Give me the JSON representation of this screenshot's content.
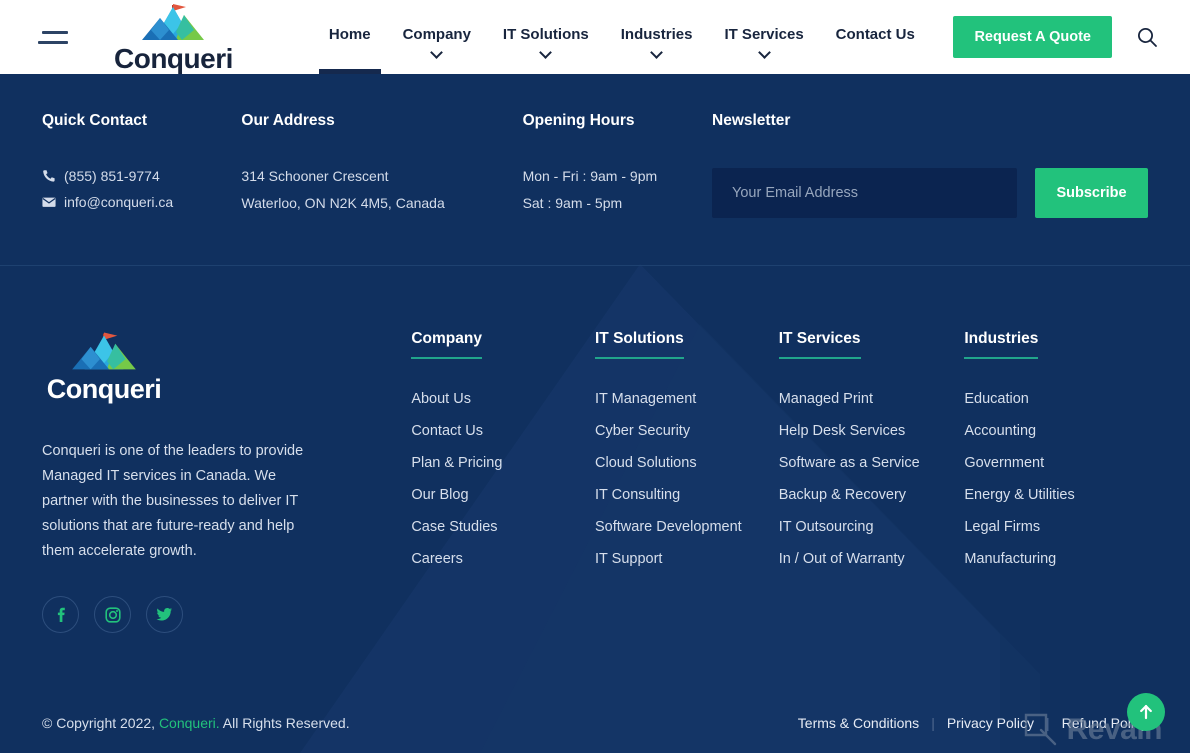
{
  "brand": {
    "name": "Conqueri",
    "accent_green": "#22c27c",
    "navy": "#10305f",
    "teal_underline": "#21a58b"
  },
  "header": {
    "menu_icon": "hamburger-icon",
    "nav": [
      {
        "label": "Home",
        "has_dropdown": false,
        "active": true
      },
      {
        "label": "Company",
        "has_dropdown": true,
        "active": false
      },
      {
        "label": "IT Solutions",
        "has_dropdown": true,
        "active": false
      },
      {
        "label": "Industries",
        "has_dropdown": true,
        "active": false
      },
      {
        "label": "IT Services",
        "has_dropdown": true,
        "active": false
      },
      {
        "label": "Contact Us",
        "has_dropdown": false,
        "active": false
      }
    ],
    "quote_button": "Request A Quote",
    "search_icon": "search-icon"
  },
  "contact_strip": {
    "quick_contact": {
      "title": "Quick Contact",
      "phone": "(855) 851-9774",
      "email": "info@conqueri.ca",
      "phone_icon": "phone-icon",
      "email_icon": "envelope-icon"
    },
    "address": {
      "title": "Our Address",
      "line1": "314 Schooner Crescent",
      "line2": "Waterloo, ON N2K 4M5, Canada"
    },
    "hours": {
      "title": "Opening Hours",
      "weekday": "Mon - Fri : 9am - 9pm",
      "saturday": "Sat : 9am - 5pm"
    },
    "newsletter": {
      "title": "Newsletter",
      "placeholder": "Your Email Address",
      "value": "",
      "subscribe_label": "Subscribe"
    }
  },
  "about": {
    "logo_name": "Conqueri",
    "description": "Conqueri is one of the leaders to provide Managed IT services in Canada. We partner with the businesses to deliver IT solutions that are future-ready and help them accelerate growth.",
    "socials": [
      {
        "name": "facebook-icon",
        "label": "Facebook"
      },
      {
        "name": "instagram-icon",
        "label": "Instagram"
      },
      {
        "name": "twitter-icon",
        "label": "Twitter"
      }
    ]
  },
  "footer_columns": [
    {
      "heading": "Company",
      "links": [
        "About Us",
        "Contact Us",
        "Plan & Pricing",
        "Our Blog",
        "Case Studies",
        "Careers"
      ]
    },
    {
      "heading": "IT Solutions",
      "links": [
        "IT Management",
        "Cyber Security",
        "Cloud Solutions",
        "IT Consulting",
        "Software Development",
        "IT Support"
      ]
    },
    {
      "heading": "IT Services",
      "links": [
        "Managed Print",
        "Help Desk Services",
        "Software as a Service",
        "Backup & Recovery",
        "IT Outsourcing",
        "In / Out of Warranty"
      ]
    },
    {
      "heading": "Industries",
      "links": [
        "Education",
        "Accounting",
        "Government",
        "Energy & Utilities",
        "Legal Firms",
        "Manufacturing"
      ]
    }
  ],
  "bottom_bar": {
    "copyright_prefix": "© Copyright 2022, ",
    "copyright_brand": "Conqueri.",
    "copyright_suffix": " All Rights Reserved.",
    "legal_links": [
      "Terms & Conditions",
      "Privacy Policy",
      "Refund Policy"
    ],
    "separator": "|",
    "scroll_top_icon": "arrow-up-icon"
  },
  "watermark": {
    "text": "Revain",
    "icon": "revain-logo-icon"
  }
}
